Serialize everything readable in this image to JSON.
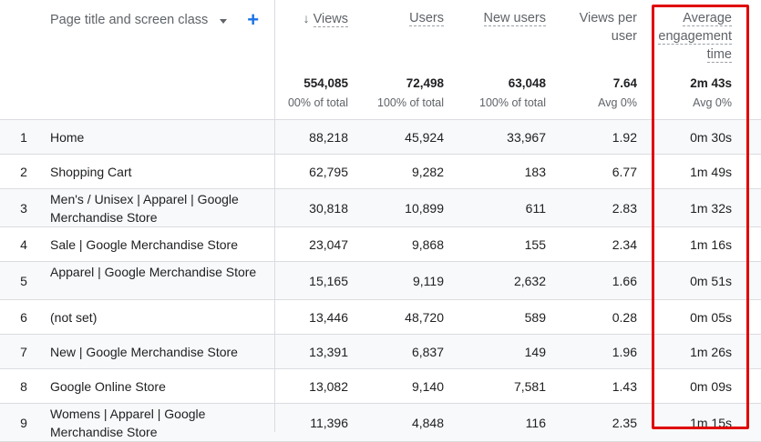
{
  "header": {
    "dimension_label": "Page title and screen class",
    "columns": [
      {
        "key": "views",
        "label_lines": [
          "Views"
        ],
        "total": "554,085",
        "sub": "00% of total",
        "sorted": true
      },
      {
        "key": "users",
        "label_lines": [
          "Users"
        ],
        "total": "72,498",
        "sub": "100% of total"
      },
      {
        "key": "new_users",
        "label_lines": [
          "New users"
        ],
        "total": "63,048",
        "sub": "100% of total"
      },
      {
        "key": "views_per_user",
        "label_lines": [
          "Views per",
          "user"
        ],
        "total": "7.64",
        "sub": "Avg 0%"
      },
      {
        "key": "avg_engagement",
        "label_lines": [
          "Average",
          "engagement",
          "time"
        ],
        "total": "2m 43s",
        "sub": "Avg 0%"
      }
    ]
  },
  "rows": [
    {
      "index": "1",
      "title": "Home",
      "views": "88,218",
      "users": "45,924",
      "new_users": "33,967",
      "vpu": "1.92",
      "aet": "0m 30s"
    },
    {
      "index": "2",
      "title": "Shopping Cart",
      "views": "62,795",
      "users": "9,282",
      "new_users": "183",
      "vpu": "6.77",
      "aet": "1m 49s"
    },
    {
      "index": "3",
      "title": "Men's / Unisex | Apparel | Google Merchandise Store",
      "views": "30,818",
      "users": "10,899",
      "new_users": "611",
      "vpu": "2.83",
      "aet": "1m 32s"
    },
    {
      "index": "4",
      "title": "Sale | Google Merchandise Store",
      "views": "23,047",
      "users": "9,868",
      "new_users": "155",
      "vpu": "2.34",
      "aet": "1m 16s"
    },
    {
      "index": "5",
      "title": "Apparel | Google Merchandise Store",
      "views": "15,165",
      "users": "9,119",
      "new_users": "2,632",
      "vpu": "1.66",
      "aet": "0m 51s"
    },
    {
      "index": "6",
      "title": "(not set)",
      "views": "13,446",
      "users": "48,720",
      "new_users": "589",
      "vpu": "0.28",
      "aet": "0m 05s"
    },
    {
      "index": "7",
      "title": "New | Google Merchandise Store",
      "views": "13,391",
      "users": "6,837",
      "new_users": "149",
      "vpu": "1.96",
      "aet": "1m 26s"
    },
    {
      "index": "8",
      "title": "Google Online Store",
      "views": "13,082",
      "users": "9,140",
      "new_users": "7,581",
      "vpu": "1.43",
      "aet": "0m 09s"
    },
    {
      "index": "9",
      "title": "Womens | Apparel | Google Merchandise Store",
      "views": "11,396",
      "users": "4,848",
      "new_users": "116",
      "vpu": "2.35",
      "aet": "1m 15s"
    }
  ],
  "colors": {
    "highlight": "#e00000",
    "accent": "#1a73e8"
  }
}
